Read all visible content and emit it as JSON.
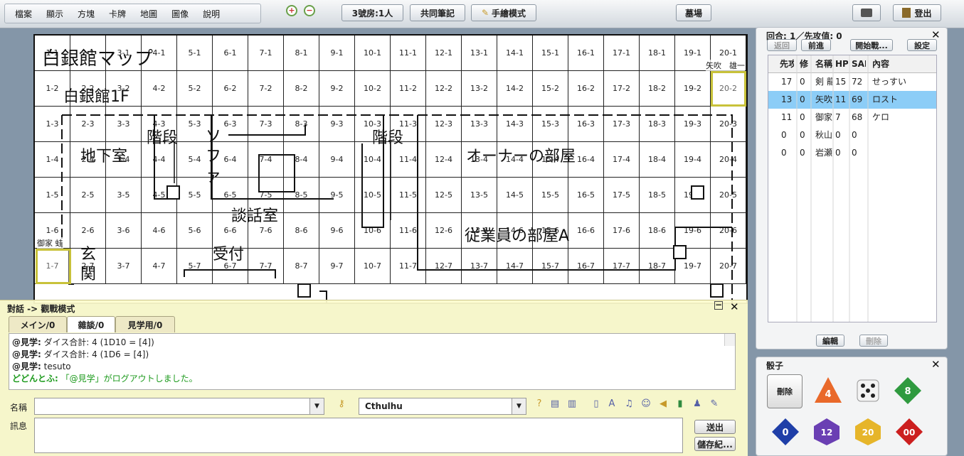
{
  "menu": [
    "檔案",
    "顯示",
    "方塊",
    "卡牌",
    "地圖",
    "圖像",
    "說明"
  ],
  "toolbar": {
    "room": "3號房:1人",
    "notes": "共同筆記",
    "draw_mode": "手繪模式",
    "graveyard": "墓場",
    "logout": "登出"
  },
  "map": {
    "title": "白銀館マップ",
    "subtitle": "白銀館1F",
    "labels": [
      "階段",
      "ソ",
      "フ",
      "ァ",
      "地下室",
      "階段",
      "オーナーの部屋",
      "談話室",
      "受付",
      "玄",
      "関",
      "従業員の部屋A"
    ],
    "cols": 20,
    "rows": 7,
    "chips": [
      {
        "name": "矢吹　雄一"
      },
      {
        "name": "御家 蛙"
      }
    ]
  },
  "chat": {
    "title": "對話 -> 觀戰模式",
    "tabs": [
      "メイン/0",
      "雜談/0",
      "見学用/0"
    ],
    "log": [
      {
        "who": "@見学:",
        "text": "ダイス合計: 4 (1D10 = [4])"
      },
      {
        "who": "@見学:",
        "text": "ダイス合計: 4 (1D6 = [4])"
      },
      {
        "who": "@見学:",
        "text": "tesuto"
      },
      {
        "who": "どどんとふ:",
        "text": "「@見学」がログアウトしました。"
      }
    ],
    "name_label": "名稱",
    "msg_label": "訊息",
    "system": "Cthulhu",
    "send": "送出",
    "save": "儲存紀..."
  },
  "initiative": {
    "title": "回合: 1／先攻值: 0",
    "buttons": [
      "返回",
      "前進",
      "開始戰...",
      "設定"
    ],
    "headers": [
      "先攻",
      "修",
      "名稱",
      "HP",
      "SAN",
      "內容"
    ],
    "rows": [
      [
        "17",
        "0",
        "剣 龍",
        "15",
        "72",
        "せっすい"
      ],
      [
        "13",
        "0",
        "矢吹",
        "11",
        "69",
        "ロスト"
      ],
      [
        "11",
        "0",
        "御家",
        "7",
        "68",
        "ケロ"
      ],
      [
        "0",
        "0",
        "秋山",
        "0",
        "0",
        ""
      ],
      [
        "0",
        "0",
        "岩瀬",
        "0",
        "0",
        ""
      ]
    ],
    "edit": "編輯",
    "delete": "刪除"
  },
  "dice": {
    "title": "骰子",
    "delete": "刪除",
    "items": [
      {
        "label": "4",
        "color": "#e9692a"
      },
      {
        "label": "6",
        "color": "#f3f3f3"
      },
      {
        "label": "8",
        "color": "#2f9a3f"
      },
      {
        "label": "0",
        "color": "#1f3fa8"
      },
      {
        "label": "12",
        "color": "#6a3fb3"
      },
      {
        "label": "20",
        "color": "#e6b52a"
      },
      {
        "label": "00",
        "color": "#cc1f1f"
      }
    ]
  }
}
